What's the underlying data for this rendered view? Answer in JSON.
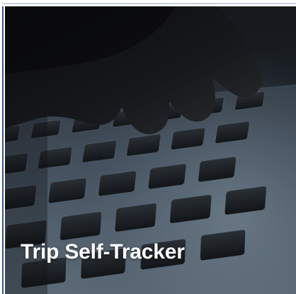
{
  "tile": {
    "title": "Trip Self-Tracker",
    "image": "laptop-keyboard-photo"
  },
  "colors": {
    "title_text": "#ffffff",
    "frame_accent": "#3b4f8c"
  }
}
